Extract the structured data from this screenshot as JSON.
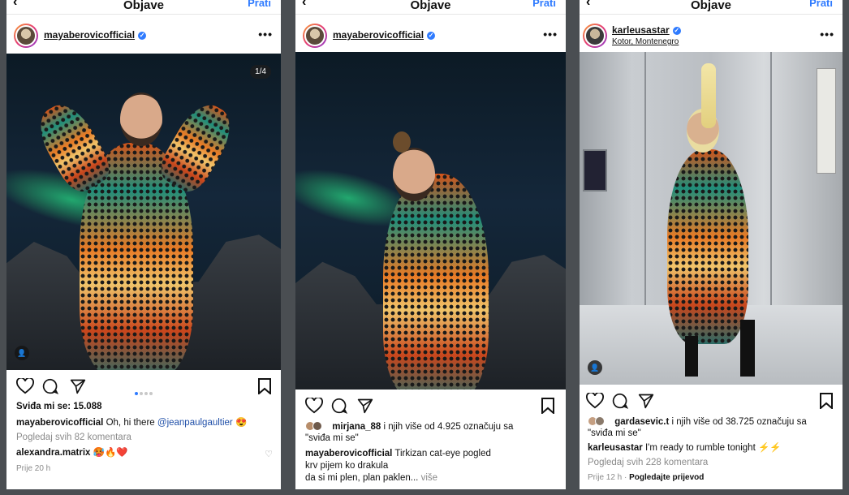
{
  "common": {
    "nav_title": "Objave",
    "follow_label": "Prati",
    "back_glyph": "‹",
    "more_glyph": "•••",
    "verified_glyph": "✓",
    "tag_glyph": "👤"
  },
  "post1": {
    "username": "mayaberovicofficial",
    "counter": "1/4",
    "likes": "Sviđa mi se: 15.088",
    "caption_user": "mayaberovicofficial",
    "caption_text": "Oh, hi there",
    "caption_mention": "@jeanpaulgaultier",
    "caption_emoji": "😍",
    "view_comments": "Pogledaj svih 82 komentara",
    "comment_user": "alexandra.matrix",
    "comment_text": "🥵🔥❤️",
    "time": "Prije 20 h"
  },
  "post2": {
    "username": "mayaberovicofficial",
    "liked_by_user": "mirjana_88",
    "liked_by_text": "i njih više od 4.925 označuju sa",
    "liked_by_text2": "\"sviđa mi se\"",
    "caption_user": "mayaberovicofficial",
    "caption_line1": "Tirkizan cat-eye pogled",
    "caption_line2": "krv pijem ko drakula",
    "caption_line3": "da si mi plen, plan paklen...",
    "more_label": "više"
  },
  "post3": {
    "username": "karleusastar",
    "location": "Kotor, Montenegro",
    "liked_by_user": "gardasevic.t",
    "liked_by_text": "i njih više od 38.725 označuju sa",
    "liked_by_text2": "\"sviđa mi se\"",
    "caption_user": "karleusastar",
    "caption_text": "I'm ready to rumble tonight ⚡⚡",
    "view_comments": "Pogledaj svih 228 komentara",
    "time": "Prije 12 h",
    "translate": "Pogledajte prijevod"
  },
  "colors": {
    "link_blue": "#2f7bff",
    "mention_blue": "#1f4fa8",
    "muted_gray": "#8a8a8a",
    "background": "#4a4e52"
  }
}
